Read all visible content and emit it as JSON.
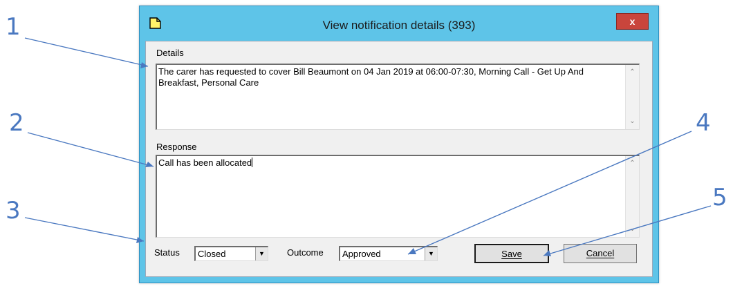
{
  "window": {
    "title": "View notification details (393)",
    "close_symbol": "x",
    "title_icon": "note-icon"
  },
  "details": {
    "label": "Details",
    "text": "The carer has requested to cover Bill Beaumont on 04 Jan 2019 at 06:00-07:30, Morning Call - Get Up And Breakfast, Personal Care"
  },
  "response": {
    "label": "Response",
    "text": "Call has been allocated"
  },
  "status": {
    "label": "Status",
    "value": "Closed"
  },
  "outcome": {
    "label": "Outcome",
    "value": "Approved"
  },
  "buttons": {
    "save": "Save",
    "cancel": "Cancel"
  },
  "callouts": [
    "1",
    "2",
    "3",
    "4",
    "5"
  ],
  "colors": {
    "callout": "#4a78c0",
    "titlebar": "#5ec4e8",
    "close": "#c9453c"
  }
}
